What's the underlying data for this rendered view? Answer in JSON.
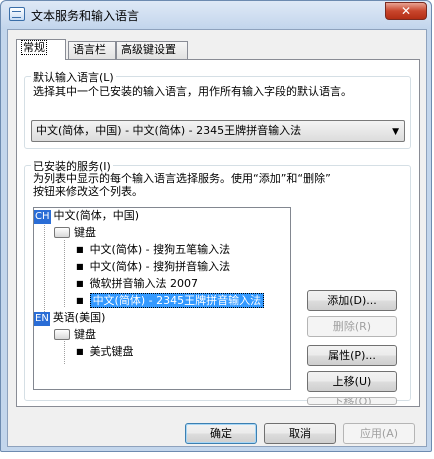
{
  "window": {
    "title": "文本服务和输入语言",
    "close_glyph": "✕"
  },
  "tabs": [
    "常规",
    "语言栏",
    "高级键设置"
  ],
  "default_group": {
    "label": "默认输入语言(L)",
    "description": "选择其中一个已安装的输入语言，用作所有输入字段的默认语言。",
    "selected": "中文(简体，中国) - 中文(简体) - 2345王牌拼音输入法",
    "arrow": "▼"
  },
  "services_group": {
    "label": "已安装的服务(I)",
    "description_line1": "为列表中显示的每个输入语言选择服务。使用“添加”和“删除”",
    "description_line2": "按钮来修改这个列表。"
  },
  "tree": {
    "lang1": {
      "badge": "CH",
      "label": "中文(简体，中国)"
    },
    "kb1": "键盘",
    "items1": [
      "中文(简体) - 搜狗五笔输入法",
      "中文(简体) - 搜狗拼音输入法",
      "微软拼音输入法 2007",
      "中文(简体) - 2345王牌拼音输入法"
    ],
    "lang2": {
      "badge": "EN",
      "label": "英语(美国)"
    },
    "kb2": "键盘",
    "items2": [
      "美式键盘"
    ],
    "bullet": "■"
  },
  "side_buttons": {
    "add": "添加(D)...",
    "remove": "删除(R)",
    "properties": "属性(P)...",
    "move_up": "上移(U)",
    "move_down": "下移(O)"
  },
  "dialog_buttons": {
    "ok": "确定",
    "cancel": "取消",
    "apply": "应用(A)"
  }
}
